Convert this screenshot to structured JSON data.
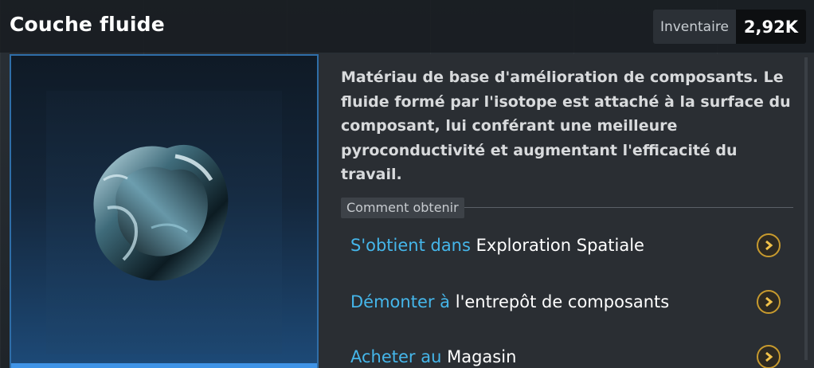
{
  "header": {
    "title": "Couche fluide",
    "inventory_label": "Inventaire",
    "inventory_value": "2,92K"
  },
  "item": {
    "image_icon": "fluid-layer-item-icon",
    "description": "Matériau de base d'amélioration de composants. Le fluide formé par l'isotope est attaché à la surface du composant, lui conférant une meilleure pyroconductivité et augmentant l'efficacité du travail."
  },
  "obtain": {
    "section_label": "Comment obtenir",
    "sources": [
      {
        "prefix": "S'obtient dans",
        "place": "Exploration Spatiale",
        "icon": "chevron-right-icon"
      },
      {
        "prefix": "Démonter à",
        "place": "l'entrepôt de composants",
        "icon": "chevron-right-icon"
      },
      {
        "prefix": "Acheter au",
        "place": "Magasin",
        "icon": "chevron-right-icon"
      }
    ]
  },
  "colors": {
    "accent_blue": "#45b6ea",
    "panel_border": "#2f6ea8",
    "button_gold": "#c79a2e"
  }
}
